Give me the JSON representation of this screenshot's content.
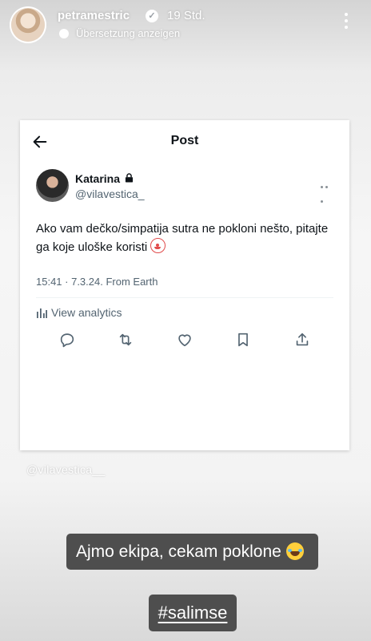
{
  "story": {
    "username": "petramestric",
    "time_ago": "19 Std.",
    "translate_label": "Übersetzung anzeigen"
  },
  "post": {
    "header_title": "Post",
    "author_name": "Katarina",
    "author_handle": "@vilavestica_",
    "text": "Ako vam dečko/simpatija sutra ne pokloni nešto, pitajte ga koje uloške koristi",
    "meta": "15:41 · 7.3.24. From Earth",
    "analytics_label": "View analytics"
  },
  "watermark": "@vilavestica__",
  "caption": "Ajmo ekipa, cekam poklone",
  "hashtag": "#salimse",
  "icons": [
    "verified-icon",
    "translate-icon",
    "more-vertical-icon",
    "back-arrow-icon",
    "lock-icon",
    "more-horizontal-icon",
    "clown-emoji-icon",
    "analytics-icon",
    "reply-icon",
    "retweet-icon",
    "like-icon",
    "bookmark-icon",
    "share-icon",
    "laugh-emoji-icon"
  ],
  "colors": {
    "story_text": "#ffffff",
    "tweet_text": "#0f1419",
    "tweet_secondary": "#536471",
    "sticker_bg": "#4e4e4e"
  }
}
